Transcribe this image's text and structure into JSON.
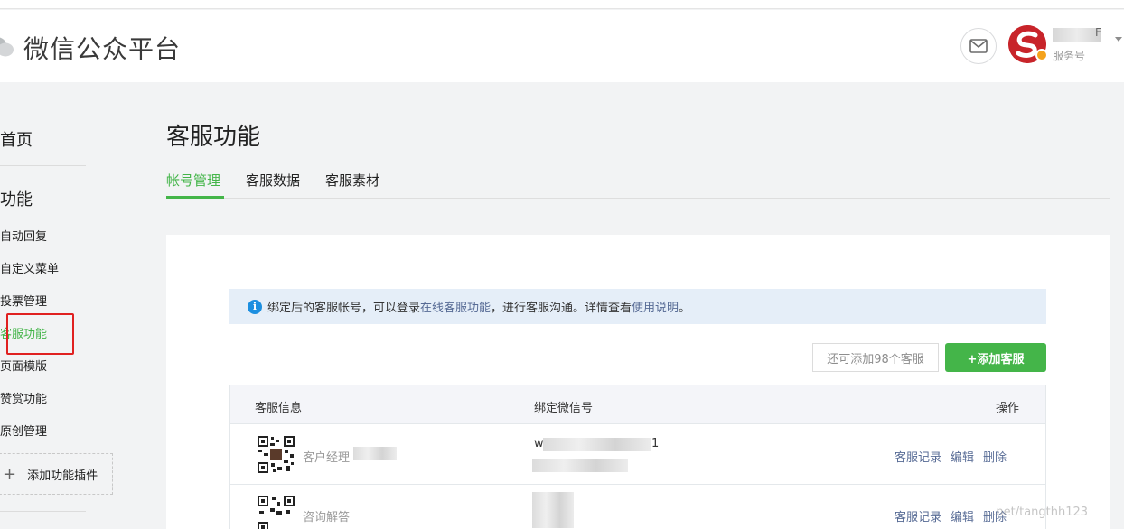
{
  "header": {
    "brand": "微信公众平台",
    "account_name_tail": "F",
    "account_type": "服务号"
  },
  "sidebar": {
    "home": "首页",
    "group": "功能",
    "items": [
      {
        "label": "自动回复"
      },
      {
        "label": "自定义菜单"
      },
      {
        "label": "投票管理"
      },
      {
        "label": "客服功能"
      },
      {
        "label": "页面模版"
      },
      {
        "label": "赞赏功能"
      },
      {
        "label": "原创管理"
      }
    ],
    "active_item": "客服功能",
    "add_plugin": "添加功能插件"
  },
  "main": {
    "title": "客服功能",
    "tabs": [
      {
        "label": "帐号管理"
      },
      {
        "label": "客服数据"
      },
      {
        "label": "客服素材"
      }
    ],
    "active_tab": "帐号管理",
    "notice": {
      "text1": "绑定后的客服帐号，可以登录",
      "link1": "在线客服功能",
      "text2": "，进行客服沟通。详情查看",
      "link2": "使用说明",
      "text3": "。"
    },
    "quota": "还可添加98个客服",
    "add_button": "+添加客服",
    "table": {
      "columns": [
        "客服信息",
        "绑定微信号",
        "操作"
      ],
      "rows": [
        {
          "name": "客户经理",
          "wechat_prefix": "w",
          "wechat_suffix": "1",
          "ops": [
            "客服记录",
            "编辑",
            "删除"
          ]
        },
        {
          "name": "咨询解答",
          "wechat_prefix": "",
          "wechat_suffix": "",
          "ops": [
            "客服记录",
            "编辑",
            "删除"
          ]
        }
      ]
    }
  },
  "watermark": "...net/tangthh123",
  "colors": {
    "accent_green": "#44b549",
    "link_blue": "#576b95",
    "notice_bg": "#e5eef8",
    "highlight_red": "#e02020"
  }
}
